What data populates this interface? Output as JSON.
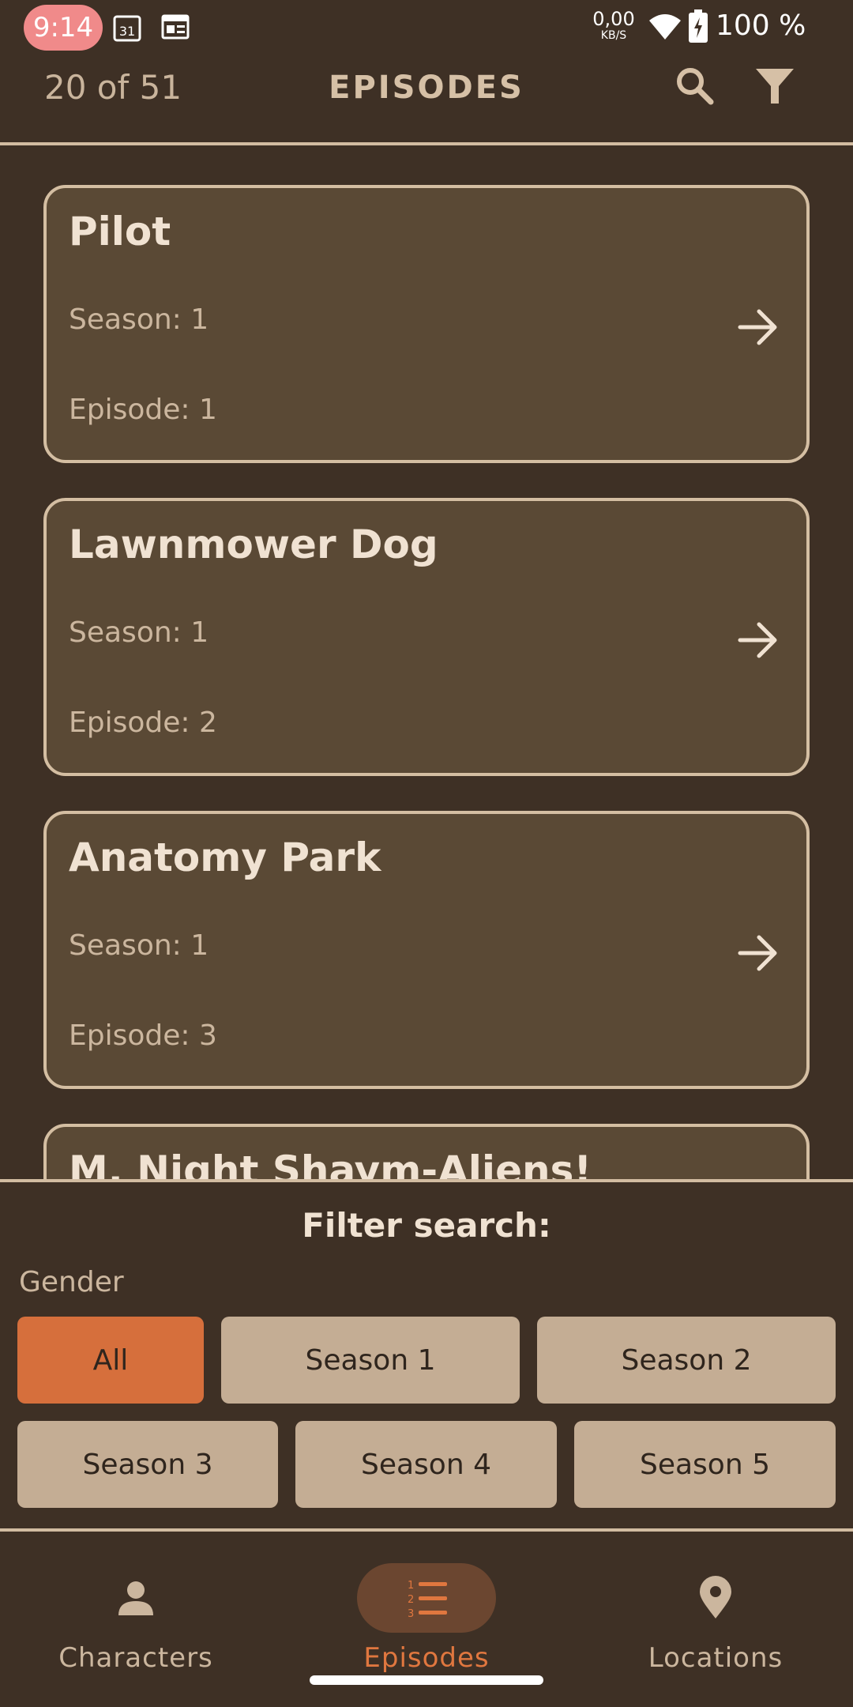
{
  "status_bar": {
    "time": "9:14",
    "calendar_day": "31",
    "net_speed_value": "0,00",
    "net_speed_unit": "KB/S",
    "battery": "100 %"
  },
  "top_bar": {
    "counter": "20 of 51",
    "title": "EPISODES",
    "icons": [
      "search-icon",
      "filter-icon"
    ]
  },
  "episodes": [
    {
      "title": "Pilot",
      "season_label": "Season:",
      "season": "1",
      "episode_label": "Episode:",
      "episode": "1"
    },
    {
      "title": "Lawnmower Dog",
      "season_label": "Season:",
      "season": "1",
      "episode_label": "Episode:",
      "episode": "2"
    },
    {
      "title": "Anatomy Park",
      "season_label": "Season:",
      "season": "1",
      "episode_label": "Episode:",
      "episode": "3"
    },
    {
      "title": "M. Night Shaym-Aliens!"
    }
  ],
  "filter": {
    "title": "Filter search:",
    "group_label": "Gender",
    "options": [
      "All",
      "Season 1",
      "Season 2",
      "Season 3",
      "Season 4",
      "Season 5"
    ],
    "selected": "All"
  },
  "bottom_nav": {
    "items": [
      {
        "label": "Characters",
        "icon": "person-icon"
      },
      {
        "label": "Episodes",
        "icon": "numbered-list-icon"
      },
      {
        "label": "Locations",
        "icon": "location-pin-icon"
      }
    ],
    "active": "Episodes"
  },
  "colors": {
    "background": "#3e3025",
    "card": "#5a4935",
    "border": "#d4bea2",
    "accent": "#d66f3c",
    "chip": "#c4ad94"
  }
}
